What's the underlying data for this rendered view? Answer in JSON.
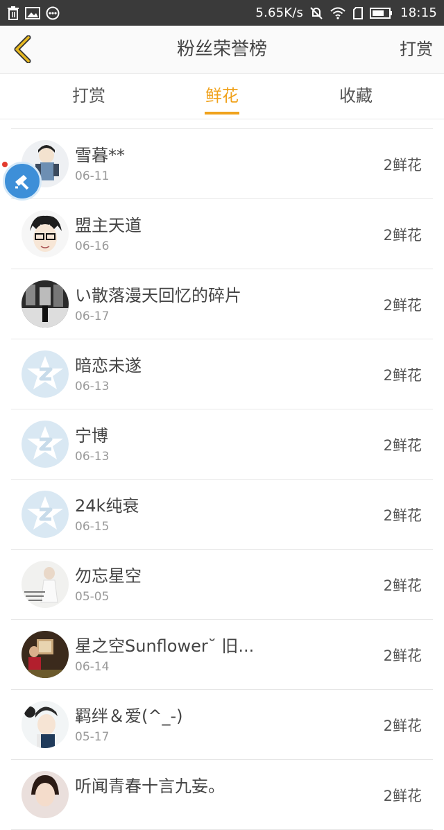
{
  "status_bar": {
    "speed": "5.65K/s",
    "time": "18:15",
    "icons_left": [
      "trash-icon",
      "image-icon",
      "more-icon"
    ],
    "icons_right": [
      "mute-icon",
      "wifi-icon",
      "sim-icon",
      "battery-icon"
    ]
  },
  "header": {
    "title": "粉丝荣誉榜",
    "action_label": "打赏",
    "back_icon": "chevron-left-icon",
    "back_color": "#d9a514"
  },
  "tabs": [
    {
      "label": "打赏",
      "active": false
    },
    {
      "label": "鲜花",
      "active": true
    },
    {
      "label": "收藏",
      "active": false
    }
  ],
  "accent_color": "#f0a21c",
  "list": [
    {
      "name": "雪暮**",
      "date": "06-11",
      "gift": "2鲜花",
      "avatar": "cartoon-avatar"
    },
    {
      "name": "盟主天道",
      "date": "06-16",
      "gift": "2鲜花",
      "avatar": "anime-avatar"
    },
    {
      "name": "い散落漫天回忆的碎片",
      "date": "06-17",
      "gift": "2鲜花",
      "avatar": "photo-avatar"
    },
    {
      "name": "暗恋未遂",
      "date": "06-13",
      "gift": "2鲜花",
      "avatar": "default-avatar"
    },
    {
      "name": "宁博",
      "date": "06-13",
      "gift": "2鲜花",
      "avatar": "default-avatar"
    },
    {
      "name": "24k纯衰",
      "date": "06-15",
      "gift": "2鲜花",
      "avatar": "default-avatar"
    },
    {
      "name": "勿忘星空",
      "date": "05-05",
      "gift": "2鲜花",
      "avatar": "photo-avatar"
    },
    {
      "name": "星之空Sunflower˘ 旧...",
      "date": "06-14",
      "gift": "2鲜花",
      "avatar": "photo-avatar"
    },
    {
      "name": "羁绊＆爱(^_-)",
      "date": "05-17",
      "gift": "2鲜花",
      "avatar": "photo-avatar"
    },
    {
      "name": "听闻青春十言九妄。",
      "date": "",
      "gift": "2鲜花",
      "avatar": "photo-avatar"
    }
  ]
}
